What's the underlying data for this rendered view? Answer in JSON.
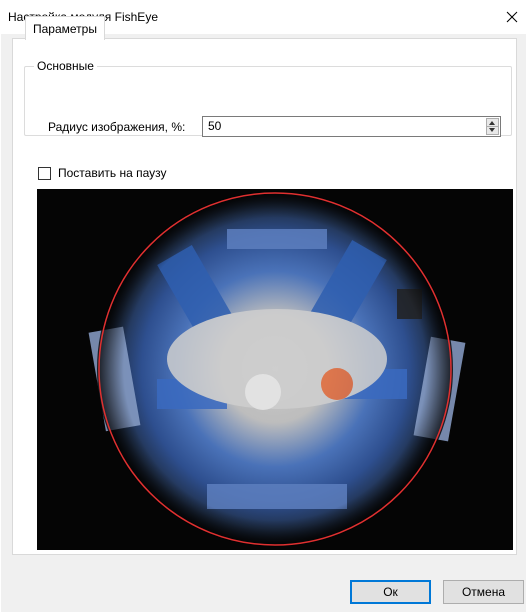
{
  "window": {
    "title": "Настройка модуля FishEye",
    "close_glyph": "✕"
  },
  "tabs": [
    {
      "label": "Параметры",
      "active": true
    }
  ],
  "group": {
    "title": "Основные",
    "field_label": "Радиус изображения, %:",
    "field_value": "50"
  },
  "pause": {
    "label": "Поставить на паузу",
    "checked": false
  },
  "preview": {
    "circle_color": "#e03030",
    "background": "#050505"
  },
  "buttons": {
    "ok": "Ок",
    "cancel": "Отмена"
  }
}
